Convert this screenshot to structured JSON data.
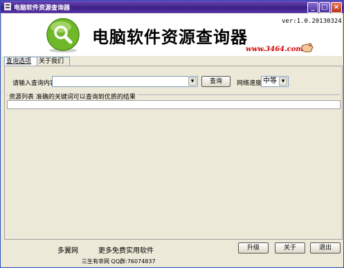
{
  "window": {
    "title": "电脑软件资源查询器",
    "controls": [
      "_",
      "□",
      "×"
    ]
  },
  "header": {
    "app_title": "电脑软件资源查询器",
    "version": "ver:1.0.20130324",
    "url": "www.3464.com"
  },
  "tabs": [
    {
      "label": "查询选项",
      "active": true
    },
    {
      "label": "关于我们",
      "active": false
    }
  ],
  "query": {
    "label": "请输入查询内容",
    "input_value": "",
    "search_button": "查询",
    "speed_label": "网络速度",
    "speed_value": "中等"
  },
  "results": {
    "group_label": "资源列表 准确的关键词可以查询到优质的结果"
  },
  "footer": {
    "link1": "多翼网",
    "link2": "更多免费实用软件",
    "upgrade": "升级",
    "about": "关于",
    "exit": "退出",
    "status": "三生有幸网 QQ群:76074837"
  },
  "colors": {
    "titlebar": "#4b2a96",
    "url": "#d20000",
    "logo_green": "#6fb82a"
  }
}
